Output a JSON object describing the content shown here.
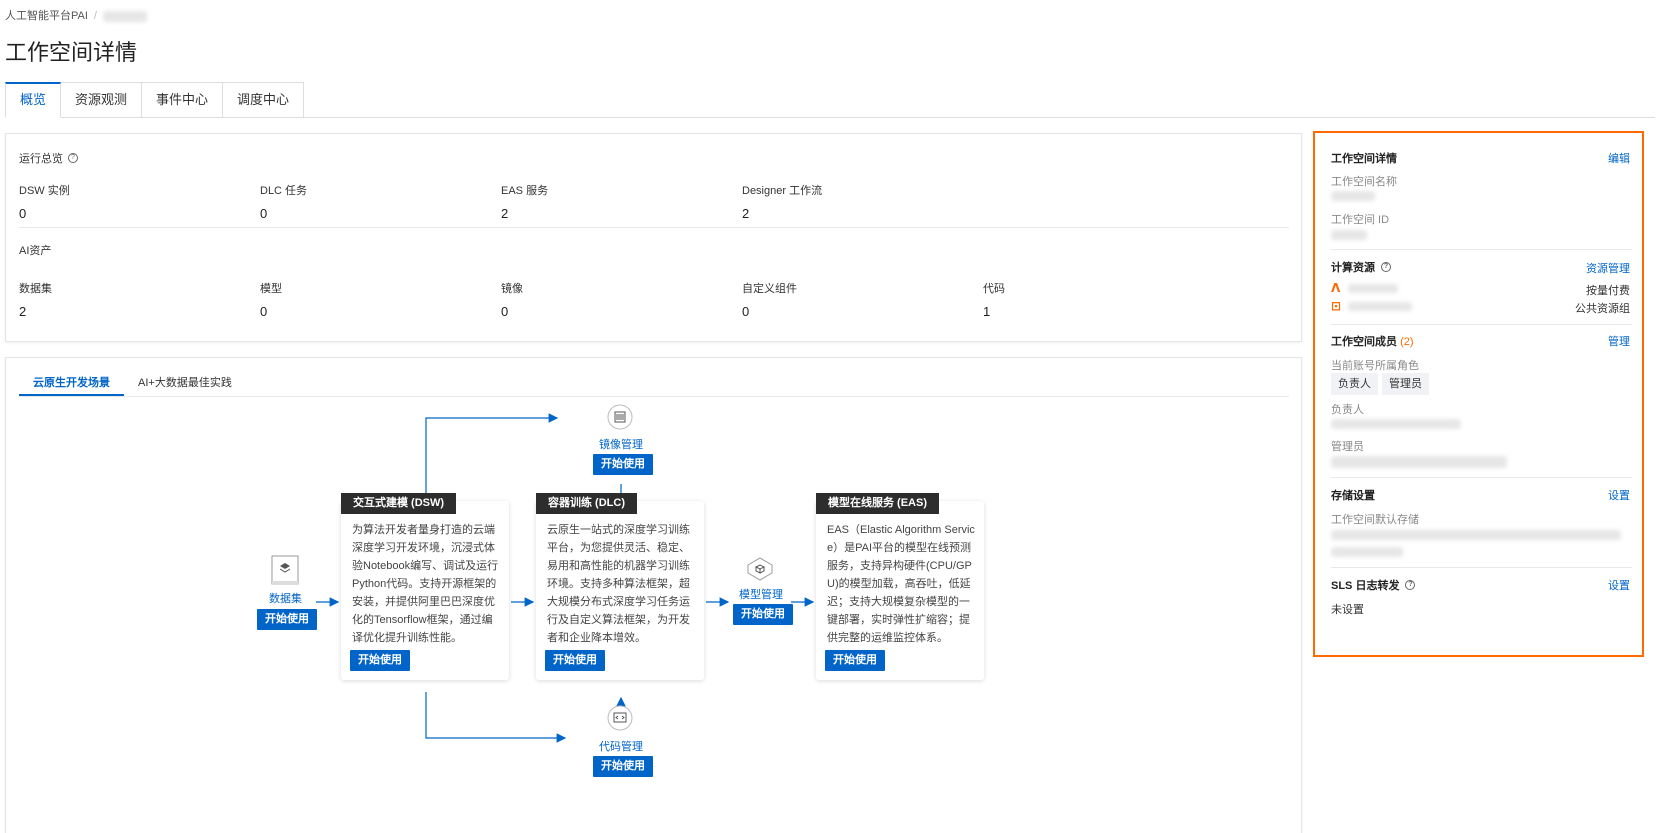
{
  "breadcrumb": {
    "root": "人工智能平台PAI"
  },
  "page_title": "工作空间详情",
  "tabs": [
    "概览",
    "资源观测",
    "事件中心",
    "调度中心"
  ],
  "overview": {
    "run_title": "运行总览",
    "run_stats": [
      {
        "label": "DSW 实例",
        "value": "0"
      },
      {
        "label": "DLC 任务",
        "value": "0"
      },
      {
        "label": "EAS 服务",
        "value": "2"
      },
      {
        "label": "Designer 工作流",
        "value": "2"
      }
    ],
    "asset_title": "AI资产",
    "asset_stats": [
      {
        "label": "数据集",
        "value": "2"
      },
      {
        "label": "模型",
        "value": "0"
      },
      {
        "label": "镜像",
        "value": "0"
      },
      {
        "label": "自定义组件",
        "value": "0"
      },
      {
        "label": "代码",
        "value": "1"
      }
    ]
  },
  "scenario": {
    "tabs": [
      "云原生开发场景",
      "AI+大数据最佳实践"
    ],
    "start_label": "开始使用",
    "dataset_label": "数据集",
    "image_label": "镜像管理",
    "code_label": "代码管理",
    "model_label": "模型管理",
    "dsw": {
      "title": "交互式建模 (DSW)",
      "desc": "为算法开发者量身打造的云端深度学习开发环境，沉浸式体验Notebook编写、调试及运行Python代码。支持开源框架的安装，并提供阿里巴巴深度优化的Tensorflow框架，通过编译优化提升训练性能。"
    },
    "dlc": {
      "title": "容器训练 (DLC)",
      "desc": "云原生一站式的深度学习训练平台，为您提供灵活、稳定、易用和高性能的机器学习训练环境。支持多种算法框架，超大规模分布式深度学习任务运行及自定义算法框架，为开发者和企业降本增效。"
    },
    "eas": {
      "title": "模型在线服务 (EAS)",
      "desc": "EAS（Elastic Algorithm Service）是PAI平台的模型在线预测服务，支持异构硬件(CPU/GPU)的模型加载，高吞吐，低延迟；支持大规模复杂模型的一键部署，实时弹性扩缩容；提供完整的运维监控体系。"
    }
  },
  "side": {
    "detail_title": "工作空间详情",
    "edit": "编辑",
    "name_label": "工作空间名称",
    "id_label": "工作空间 ID",
    "compute_title": "计算资源",
    "compute_link": "资源管理",
    "billing_pay": "按量付费",
    "billing_public": "公共资源组",
    "members_title": "工作空间成员",
    "members_count": "(2)",
    "members_link": "管理",
    "role_label": "当前账号所属角色",
    "roles": [
      "负责人",
      "管理员"
    ],
    "owner_label": "负责人",
    "admin_label": "管理员",
    "storage_title": "存储设置",
    "storage_link": "设置",
    "storage_default": "工作空间默认存储",
    "sls_title": "SLS 日志转发",
    "sls_link": "设置",
    "sls_value": "未设置",
    "colors": {
      "accent": "#0064c8",
      "highlight": "#ff6a00"
    }
  }
}
